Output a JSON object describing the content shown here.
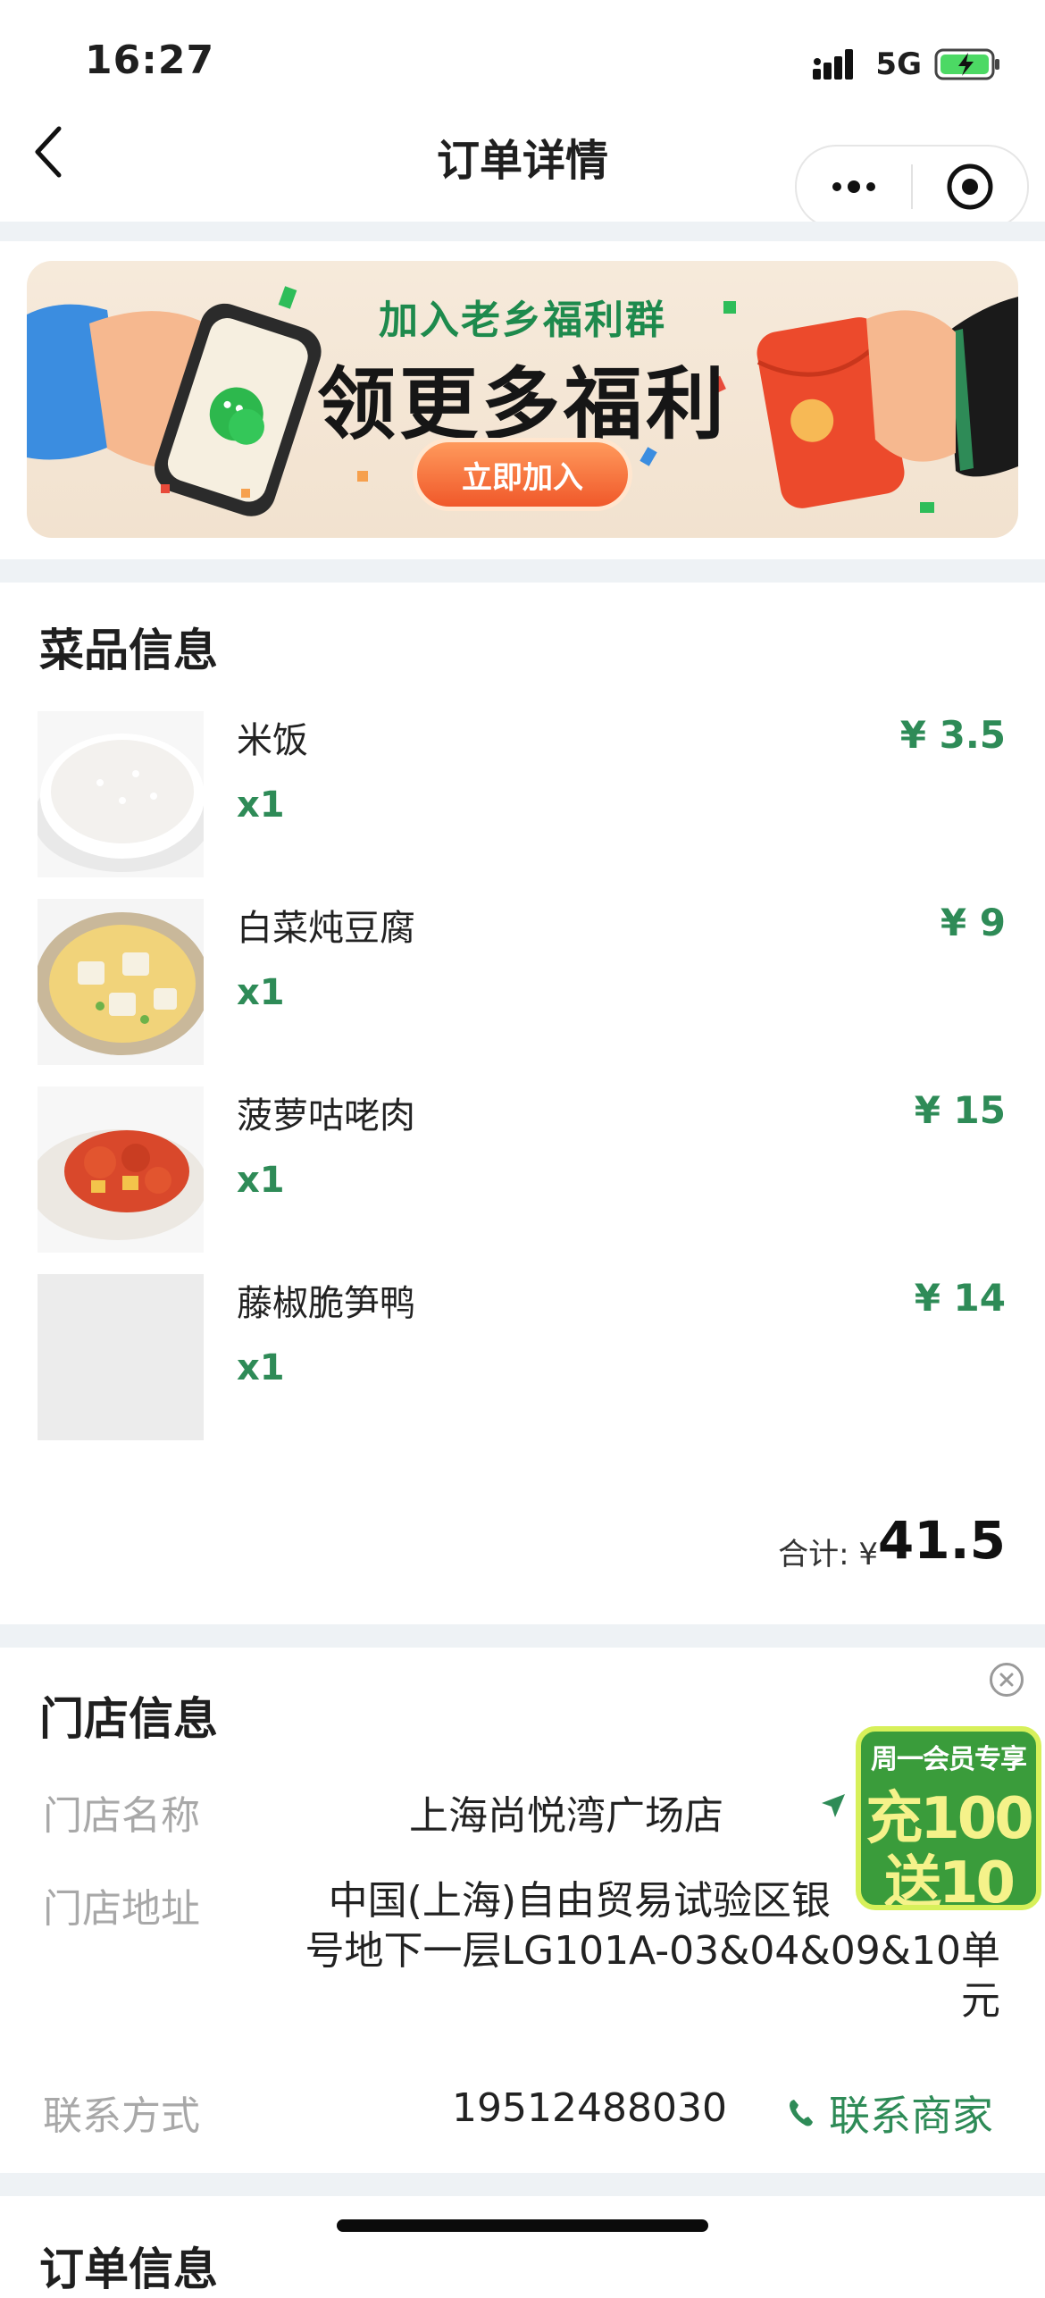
{
  "status_bar": {
    "time": "16:27",
    "network": "5G"
  },
  "header": {
    "title": "订单详情"
  },
  "banner": {
    "subtitle": "加入老乡福利群",
    "headline": "领更多福利",
    "button": "立即加入"
  },
  "dishes_section": {
    "title": "菜品信息",
    "items": [
      {
        "name": "米饭",
        "qty": "x1",
        "price": "¥ 3.5"
      },
      {
        "name": "白菜炖豆腐",
        "qty": "x1",
        "price": "¥ 9"
      },
      {
        "name": "菠萝咕咾肉",
        "qty": "x1",
        "price": "¥ 15"
      },
      {
        "name": "藤椒脆笋鸭",
        "qty": "x1",
        "price": "¥ 14"
      }
    ],
    "total_label": "合计: ¥",
    "total_value": "41.5"
  },
  "store_section": {
    "title": "门店信息",
    "name_label": "门店名称",
    "name_value": "上海尚悦湾广场店",
    "address_label": "门店地址",
    "address_line1": "中国(上海)自由贸易试验区银",
    "address_line2": "号地下一层LG101A-03&04&09&10单",
    "address_line3": "元",
    "contact_label": "联系方式",
    "contact_phone": "19512488030",
    "contact_button": "联系商家"
  },
  "promo": {
    "top": "周一会员专享",
    "line1": "充100",
    "line2": "送10"
  },
  "order_section": {
    "title": "订单信息"
  },
  "colors": {
    "accent": "#2e8b57",
    "separator": "#eef2f5"
  }
}
